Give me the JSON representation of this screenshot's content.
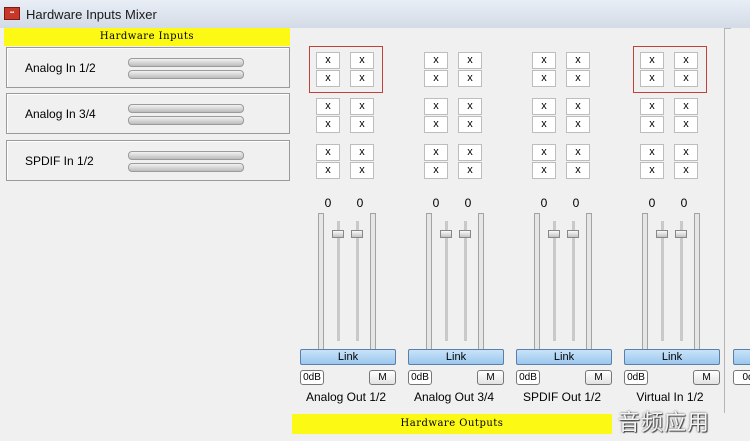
{
  "window": {
    "title": "Hardware Inputs Mixer",
    "icon": "app-logo-icon"
  },
  "inputs": {
    "header": "Hardware Inputs",
    "rows": [
      {
        "label": "Analog In  1/2"
      },
      {
        "label": "Analog In  3/4"
      },
      {
        "label": "SPDIF In 1/2"
      }
    ]
  },
  "outputs": {
    "header": "Hardware Outputs",
    "routing_mark": "x",
    "channels": [
      {
        "name": "Analog Out 1/2",
        "gain_left": "0",
        "gain_right": "0",
        "link": "Link",
        "odb": "0dB",
        "mute": "M",
        "highlighted": true
      },
      {
        "name": "Analog Out 3/4",
        "gain_left": "0",
        "gain_right": "0",
        "link": "Link",
        "odb": "0dB",
        "mute": "M",
        "highlighted": false
      },
      {
        "name": "SPDIF Out 1/2",
        "gain_left": "0",
        "gain_right": "0",
        "link": "Link",
        "odb": "0dB",
        "mute": "M",
        "highlighted": false
      },
      {
        "name": "Virtual In 1/2",
        "gain_left": "0",
        "gain_right": "0",
        "link": "Link",
        "odb": "0dB",
        "mute": "M",
        "highlighted": true
      }
    ],
    "partial_channel": {
      "odb": "0d"
    }
  },
  "watermark": "音频应用",
  "colors": {
    "header_yellow": "#fcf914",
    "selection_red": "#c0403a",
    "link_blue": "#9cc7ee"
  }
}
